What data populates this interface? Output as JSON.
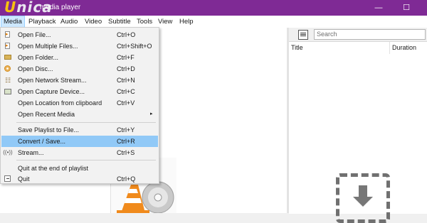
{
  "titlebar": {
    "logo_u": "U",
    "logo_rest": "nica",
    "title": "media player",
    "minimize": "—",
    "maximize": "☐"
  },
  "menubar": {
    "items": [
      "Media",
      "Playback",
      "Audio",
      "Video",
      "Subtitle",
      "Tools",
      "View",
      "Help"
    ]
  },
  "media_menu": {
    "items": [
      {
        "label": "Open File...",
        "shortcut": "Ctrl+O",
        "icon": "open-file-icon"
      },
      {
        "label": "Open Multiple Files...",
        "shortcut": "Ctrl+Shift+O",
        "icon": "open-multiple-files-icon"
      },
      {
        "label": "Open Folder...",
        "shortcut": "Ctrl+F",
        "icon": "folder-icon"
      },
      {
        "label": "Open Disc...",
        "shortcut": "Ctrl+D",
        "icon": "disc-icon"
      },
      {
        "label": "Open Network Stream...",
        "shortcut": "Ctrl+N",
        "icon": "network-icon"
      },
      {
        "label": "Open Capture Device...",
        "shortcut": "Ctrl+C",
        "icon": "capture-device-icon"
      },
      {
        "label": "Open Location from clipboard",
        "shortcut": "Ctrl+V",
        "icon": ""
      },
      {
        "label": "Open Recent Media",
        "shortcut": "",
        "icon": "",
        "submenu": "▸"
      },
      {
        "label": "Save Playlist to File...",
        "shortcut": "Ctrl+Y",
        "icon": ""
      },
      {
        "label": "Convert / Save...",
        "shortcut": "Ctrl+R",
        "icon": ""
      },
      {
        "label": "Stream...",
        "shortcut": "Ctrl+S",
        "icon": "stream-icon"
      },
      {
        "label": "Quit at the end of playlist",
        "shortcut": "",
        "icon": ""
      },
      {
        "label": "Quit",
        "shortcut": "Ctrl+Q",
        "icon": "quit-icon"
      }
    ],
    "highlighted_index": 9
  },
  "playlist": {
    "search_placeholder": "Search",
    "columns": [
      "Title",
      "Duration"
    ]
  },
  "colors": {
    "titlebar": "#7f2a95",
    "highlight": "#91c9f7",
    "menu_active": "#cde8ff"
  }
}
